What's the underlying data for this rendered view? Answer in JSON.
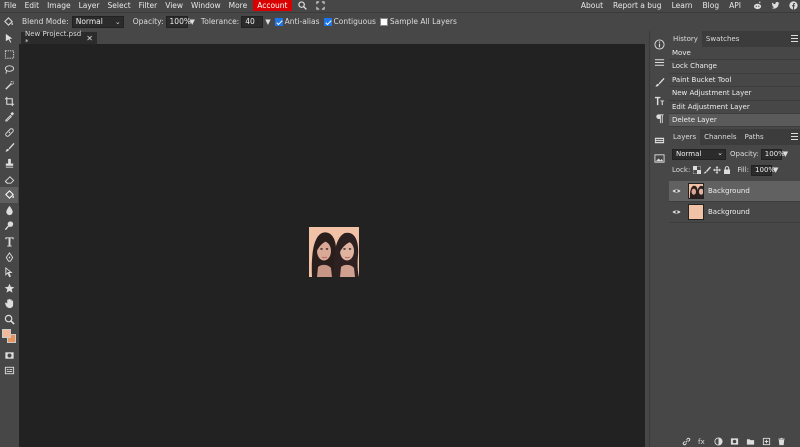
{
  "menu": {
    "items": [
      "File",
      "Edit",
      "Image",
      "Layer",
      "Select",
      "Filter",
      "View",
      "Window",
      "More"
    ],
    "account": "Account",
    "right_items": [
      "About",
      "Report a bug",
      "Learn",
      "Blog",
      "API"
    ]
  },
  "options": {
    "blend_label": "Blend Mode:",
    "blend_value": "Normal",
    "opacity_label": "Opacity:",
    "opacity_value": "100%",
    "tolerance_label": "Tolerance:",
    "tolerance_value": "40",
    "antialias_label": "Anti-alias",
    "antialias_checked": true,
    "contiguous_label": "Contiguous",
    "contiguous_checked": true,
    "sample_label": "Sample All Layers",
    "sample_checked": false
  },
  "document": {
    "tab_title": "New Project.psd *",
    "close": "✕"
  },
  "history": {
    "tabs": [
      "History",
      "Swatches"
    ],
    "items": [
      "Move",
      "Lock Change",
      "Paint Bucket Tool",
      "New Adjustment Layer",
      "Edit Adjustment Layer",
      "Delete Layer"
    ]
  },
  "layers": {
    "tabs": [
      "Layers",
      "Channels",
      "Paths"
    ],
    "blend_value": "Normal",
    "opacity_label": "Opacity:",
    "opacity_value": "100%",
    "lock_label": "Lock:",
    "fill_label": "Fill:",
    "fill_value": "100%",
    "items": [
      {
        "name": "Background",
        "selected": true
      },
      {
        "name": "Background",
        "selected": false
      }
    ]
  },
  "colors": {
    "foreground": "#f2b899",
    "background": "#e8945a",
    "accent_red": "#d80000",
    "canvas_bg": "#f2c2a6"
  }
}
